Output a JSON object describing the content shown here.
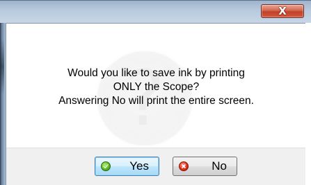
{
  "dialog": {
    "close_glyph": "X",
    "message_lines": [
      "Would you like to save ink by printing",
      "ONLY the Scope?",
      "Answering No will print the entire screen."
    ],
    "watermark_icon": "question-mark-icon",
    "watermark_glyph": "?"
  },
  "buttons": {
    "yes": {
      "label": "Yes",
      "icon": "check-icon",
      "is_default": true
    },
    "no": {
      "label": "No",
      "icon": "cross-icon"
    }
  },
  "colors": {
    "close_button": "#c1422a",
    "yes_icon": "#5fba27",
    "no_icon": "#e0321c",
    "button_bar": "#f0f0f0"
  }
}
